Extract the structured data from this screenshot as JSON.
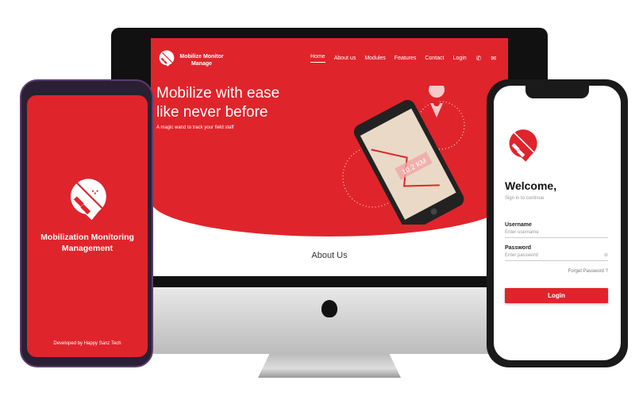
{
  "website": {
    "brand": "Mobilize Monitor Manage",
    "nav": [
      "Home",
      "About us",
      "Modules",
      "Features",
      "Contact",
      "Login"
    ],
    "active_nav": "Home",
    "hero_title_line1": "Mobilize with ease",
    "hero_title_line2": "like never before",
    "hero_subtitle": "A magic wand to track your field staff",
    "illustration_distance": "10.2 KM",
    "section_title": "About Us",
    "icons": [
      "phone-icon",
      "mail-icon"
    ]
  },
  "splash_app": {
    "title": "Mobilization Monitoring Management",
    "footer": "Developed by Happy Sanz Tech"
  },
  "login_app": {
    "welcome": "Welcome,",
    "subtitle": "Sign in to continue",
    "username_label": "Username",
    "username_placeholder": "Enter username",
    "password_label": "Password",
    "password_placeholder": "Enter password",
    "forgot": "Forget Password ?",
    "login_button": "Login"
  },
  "colors": {
    "brand_red": "#e0242b"
  }
}
